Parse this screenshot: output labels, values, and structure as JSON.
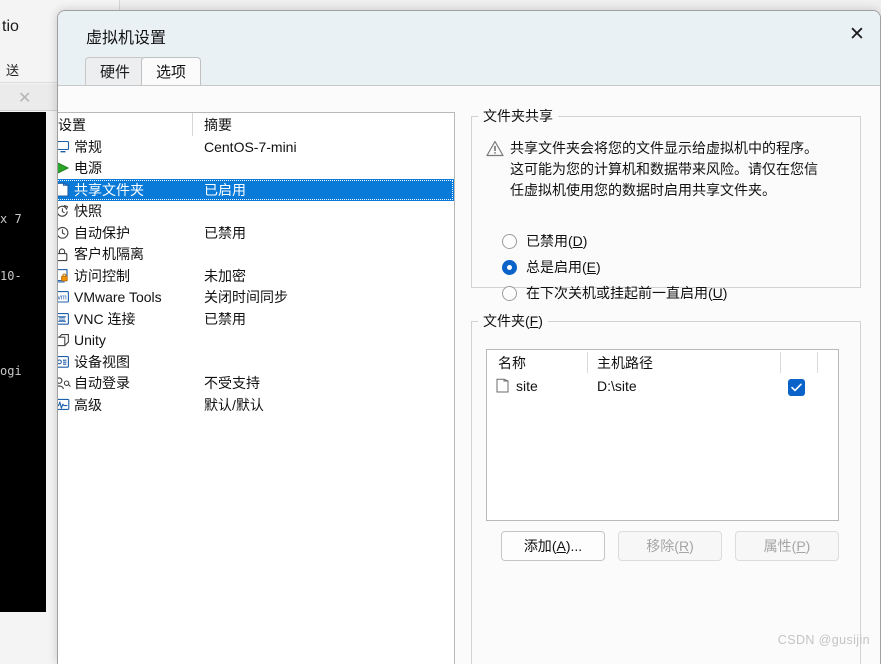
{
  "background_window": {
    "title_fragment": "tio",
    "menu_fragment": "送",
    "terminal_lines": [
      "x 7",
      "10-",
      "",
      "ogi"
    ]
  },
  "dialog": {
    "title": "虚拟机设置",
    "close_icon": "close-icon",
    "tabs": [
      {
        "label": "硬件",
        "active": false
      },
      {
        "label": "选项",
        "active": true
      }
    ]
  },
  "settings_list": {
    "columns": {
      "name": "设置",
      "summary": "摘要"
    },
    "rows": [
      {
        "icon": "monitor-icon",
        "label": "常规",
        "summary": "CentOS-7-mini",
        "selected": false
      },
      {
        "icon": "play-icon",
        "label": "电源",
        "summary": "",
        "selected": false
      },
      {
        "icon": "shared-folder-icon",
        "label": "共享文件夹",
        "summary": "已启用",
        "selected": true
      },
      {
        "icon": "snapshot-icon",
        "label": "快照",
        "summary": "",
        "selected": false
      },
      {
        "icon": "clock-icon",
        "label": "自动保护",
        "summary": "已禁用",
        "selected": false
      },
      {
        "icon": "lock-icon",
        "label": "客户机隔离",
        "summary": "",
        "selected": false
      },
      {
        "icon": "access-lock-icon",
        "label": "访问控制",
        "summary": "未加密",
        "selected": false
      },
      {
        "icon": "vmware-tools-icon",
        "label": "VMware Tools",
        "summary": "关闭时间同步",
        "selected": false
      },
      {
        "icon": "vnc-icon",
        "label": "VNC 连接",
        "summary": "已禁用",
        "selected": false
      },
      {
        "icon": "unity-icon",
        "label": "Unity",
        "summary": "",
        "selected": false
      },
      {
        "icon": "device-view-icon",
        "label": "设备视图",
        "summary": "",
        "selected": false
      },
      {
        "icon": "auto-login-icon",
        "label": "自动登录",
        "summary": "不受支持",
        "selected": false
      },
      {
        "icon": "advanced-icon",
        "label": "高级",
        "summary": "默认/默认",
        "selected": false
      }
    ]
  },
  "folder_sharing": {
    "legend": "文件夹共享",
    "warning_icon": "warning-triangle-icon",
    "warning_text": "共享文件夹会将您的文件显示给虚拟机中的程序。这可能为您的计算机和数据带来风险。请仅在您信任虚拟机使用您的数据时启用共享文件夹。",
    "options": [
      {
        "label": "已禁用",
        "accelerator": "D",
        "checked": false
      },
      {
        "label": "总是启用",
        "accelerator": "E",
        "checked": true
      },
      {
        "label": "在下次关机或挂起前一直启用",
        "accelerator": "U",
        "checked": false
      }
    ]
  },
  "folders": {
    "legend": "文件夹",
    "legend_accelerator": "F",
    "columns": {
      "name": "名称",
      "host_path": "主机路径"
    },
    "rows": [
      {
        "icon": "folder-icon",
        "name": "site",
        "host_path": "D:\\site",
        "enabled": true
      }
    ],
    "buttons": [
      {
        "label": "添加",
        "accelerator": "A",
        "suffix": "...",
        "disabled": false
      },
      {
        "label": "移除",
        "accelerator": "R",
        "suffix": "",
        "disabled": true
      },
      {
        "label": "属性",
        "accelerator": "P",
        "suffix": "",
        "disabled": true
      }
    ]
  },
  "watermark": "CSDN @gusijin",
  "colors": {
    "selection_blue": "#0a7ad8",
    "accent_blue": "#0a63c9",
    "titlebar": "#eaf1f5"
  }
}
